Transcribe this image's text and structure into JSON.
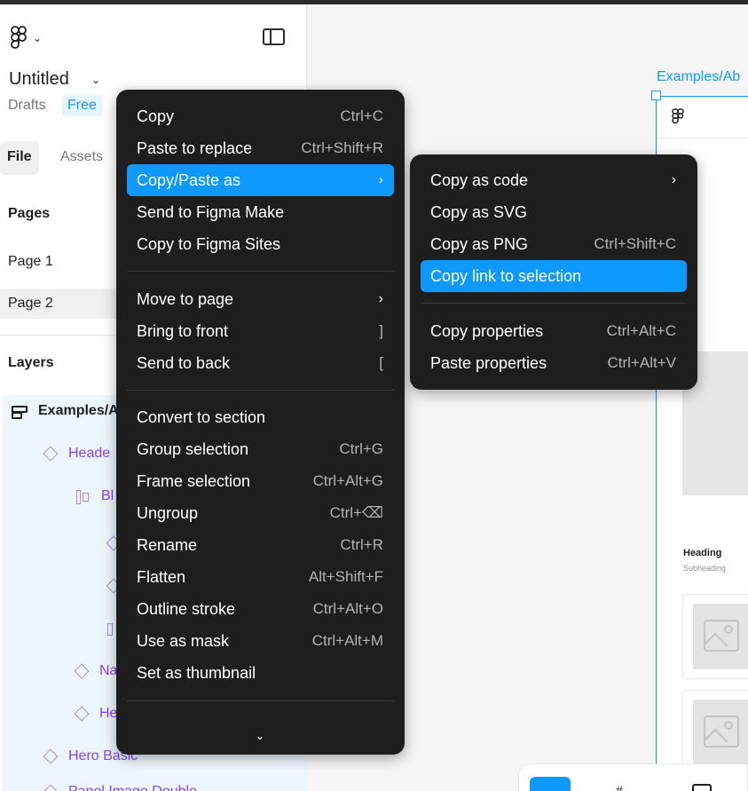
{
  "header": {
    "file_title": "Untitled",
    "drafts_label": "Drafts",
    "plan_badge": "Free"
  },
  "sidebar": {
    "tabs": [
      {
        "label": "File"
      },
      {
        "label": "Assets"
      }
    ],
    "pages_heading": "Pages",
    "pages": [
      {
        "label": "Page 1"
      },
      {
        "label": "Page 2"
      }
    ],
    "layers_heading": "Layers",
    "layers": [
      {
        "label": "Examples/A"
      },
      {
        "label": "Heade"
      },
      {
        "label": "Bl"
      },
      {
        "label": "Na"
      },
      {
        "label": "He"
      },
      {
        "label": "Hero Basic"
      },
      {
        "label": "Panel Image Double"
      }
    ]
  },
  "canvas": {
    "frame_label": "Examples/Ab",
    "card_heading": "Heading",
    "card_subheading": "Subheading"
  },
  "context_menu": {
    "items": [
      {
        "label": "Copy",
        "shortcut": "Ctrl+C"
      },
      {
        "label": "Paste to replace",
        "shortcut": "Ctrl+Shift+R"
      },
      {
        "label": "Copy/Paste as",
        "shortcut": "›"
      },
      {
        "label": "Send to Figma Make",
        "shortcut": ""
      },
      {
        "label": "Copy to Figma Sites",
        "shortcut": ""
      },
      {
        "label": "Move to page",
        "shortcut": "›"
      },
      {
        "label": "Bring to front",
        "shortcut": "]"
      },
      {
        "label": "Send to back",
        "shortcut": "["
      },
      {
        "label": "Convert to section",
        "shortcut": ""
      },
      {
        "label": "Group selection",
        "shortcut": "Ctrl+G"
      },
      {
        "label": "Frame selection",
        "shortcut": "Ctrl+Alt+G"
      },
      {
        "label": "Ungroup",
        "shortcut": "Ctrl+⌫"
      },
      {
        "label": "Rename",
        "shortcut": "Ctrl+R"
      },
      {
        "label": "Flatten",
        "shortcut": "Alt+Shift+F"
      },
      {
        "label": "Outline stroke",
        "shortcut": "Ctrl+Alt+O"
      },
      {
        "label": "Use as mask",
        "shortcut": "Ctrl+Alt+M"
      },
      {
        "label": "Set as thumbnail",
        "shortcut": ""
      }
    ],
    "more_indicator": "⌄"
  },
  "submenu": {
    "items": [
      {
        "label": "Copy as code",
        "shortcut": "›"
      },
      {
        "label": "Copy as SVG",
        "shortcut": ""
      },
      {
        "label": "Copy as PNG",
        "shortcut": "Ctrl+Shift+C"
      },
      {
        "label": "Copy link to selection",
        "shortcut": ""
      },
      {
        "label": "Copy properties",
        "shortcut": "Ctrl+Alt+C"
      },
      {
        "label": "Paste properties",
        "shortcut": "Ctrl+Alt+V"
      }
    ]
  },
  "colors": {
    "accent": "#0d99ff",
    "menu_bg": "#1e1e1e",
    "component_purple": "#8a3ffc"
  }
}
